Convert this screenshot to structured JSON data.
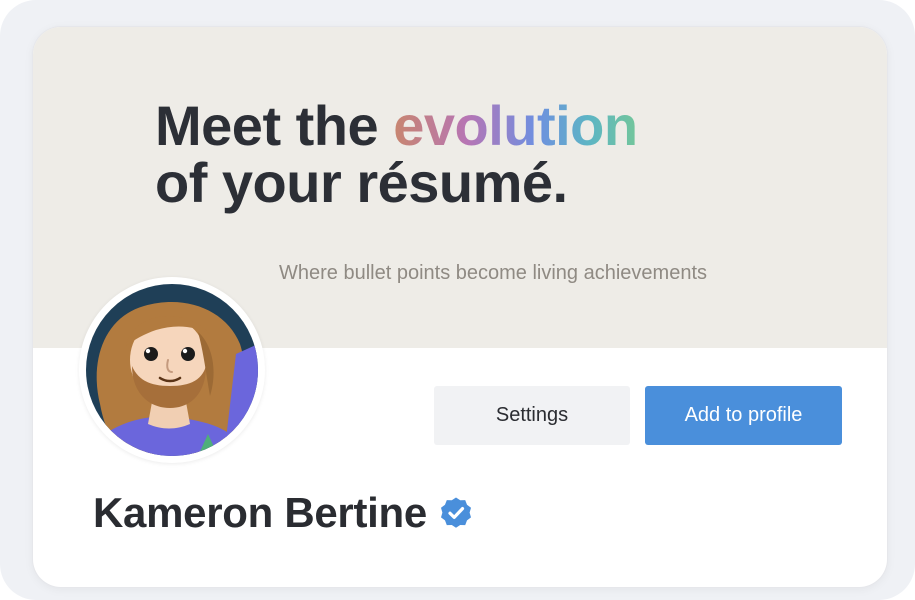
{
  "banner": {
    "headline_line1_prefix": "Meet the ",
    "headline_highlight": "evolution",
    "headline_line2": "of your résumé.",
    "tagline": "Where bullet points become living achievements"
  },
  "actions": {
    "settings_label": "Settings",
    "add_label": "Add to profile"
  },
  "profile": {
    "name": "Kameron Bertine",
    "verified_icon": "verified-check-icon",
    "avatar_icon": "avatar-illustration"
  },
  "colors": {
    "accent": "#4a8fdb",
    "banner_bg": "#eeece7",
    "text": "#2a2c31",
    "tagline": "#8f8a83"
  }
}
